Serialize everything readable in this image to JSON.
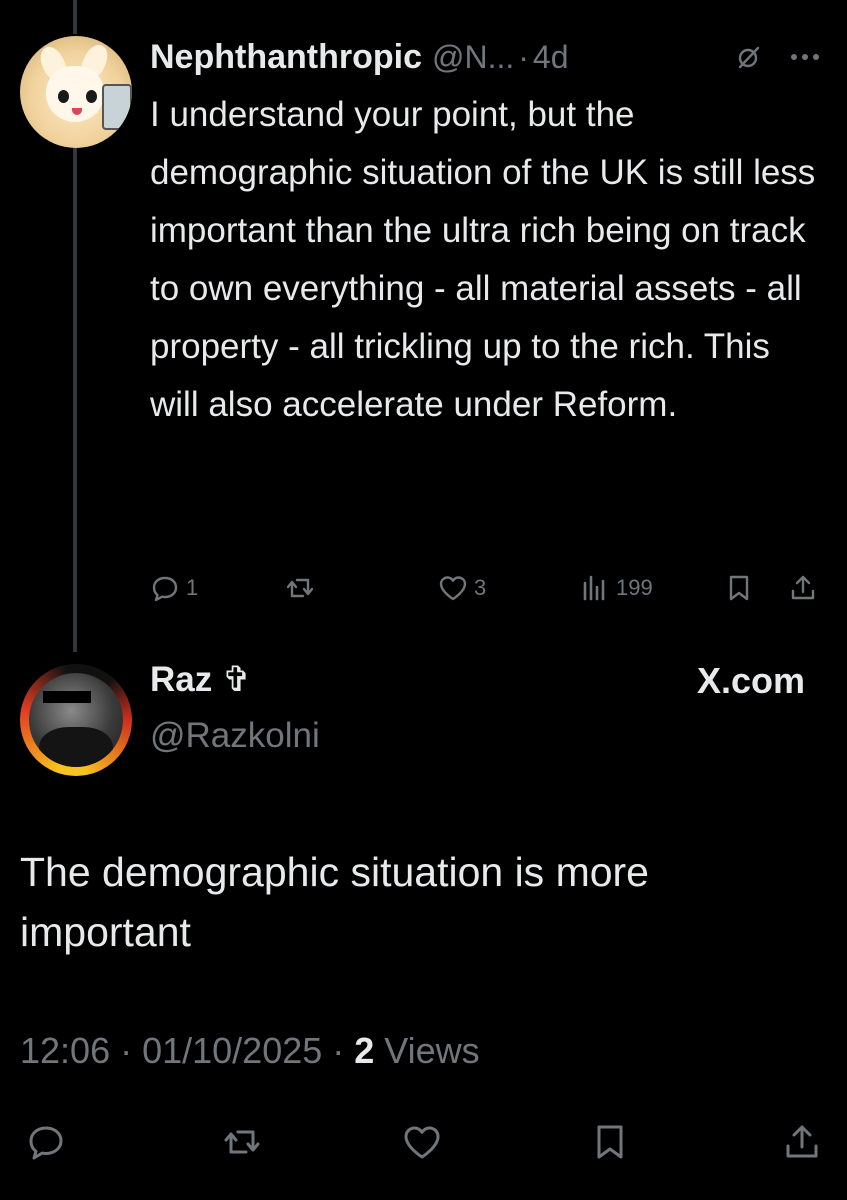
{
  "tweet": {
    "display_name": "Nephthanthropic",
    "handle": "@N...",
    "separator": "·",
    "time": "4d",
    "text": "I understand your point, but the demographic situation of the UK is still less important than the ultra rich being on track to own everything - all material assets - all property - all trickling up to the rich. This will also accelerate under Reform.",
    "actions": {
      "reply_count": "1",
      "like_count": "3",
      "views_count": "199"
    }
  },
  "reply": {
    "display_name": "Raz ✞",
    "handle": "@Razkolni",
    "watermark": "X.com",
    "text": "The demographic situation is more important",
    "timestamp": "12:06 · 01/10/2025 · ",
    "views_count": "2",
    "views_label": " Views"
  },
  "icons": {
    "grok": "slashed-circle-icon",
    "more": "more-dots-icon",
    "reply": "reply-icon",
    "retweet": "retweet-icon",
    "like": "heart-icon",
    "views": "views-chart-icon",
    "bookmark": "bookmark-icon",
    "share": "share-icon"
  },
  "colors": {
    "background": "#000000",
    "text": "#e7e9ea",
    "muted": "#71767b",
    "thread_line": "#333639"
  }
}
